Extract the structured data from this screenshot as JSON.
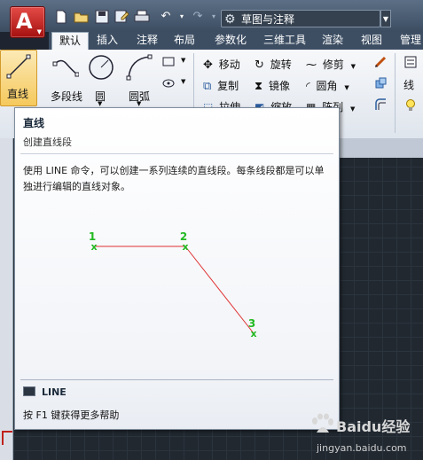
{
  "quick_access": {
    "workspace_value": "草图与注释"
  },
  "tabs": [
    "默认",
    "插入",
    "注释",
    "布局",
    "参数化",
    "三维工具",
    "渲染",
    "视图",
    "管理"
  ],
  "ribbon": {
    "draw": {
      "line": "直线",
      "polyline": "多段线",
      "circle": "圆",
      "arc": "圆弧"
    },
    "modify": {
      "move": "移动",
      "rotate": "旋转",
      "trim": "修剪",
      "copy": "复制",
      "mirror": "镜像",
      "fillet": "圆角",
      "stretch": "拉伸",
      "scale": "缩放",
      "array": "阵列"
    },
    "layers": {
      "line_label": "线"
    }
  },
  "tooltip": {
    "title": "直线",
    "subtitle": "创建直线段",
    "description": "使用 LINE 命令，可以创建一系列连续的直线段。每条线段都是可以单独进行编辑的直线对象。",
    "points": [
      {
        "label": "1"
      },
      {
        "label": "2"
      },
      {
        "label": "3"
      }
    ],
    "command": "LINE",
    "help": "按 F1 键获得更多帮助"
  },
  "watermark": {
    "brand": "Baidu经验",
    "url": "jingyan.baidu.com"
  },
  "colors": {
    "app_red": "#c0201c",
    "point_green": "#22b922",
    "line_red": "#e03030",
    "ribbon_bg": "#eef1f5",
    "tab_bar": "#3d4e63"
  }
}
